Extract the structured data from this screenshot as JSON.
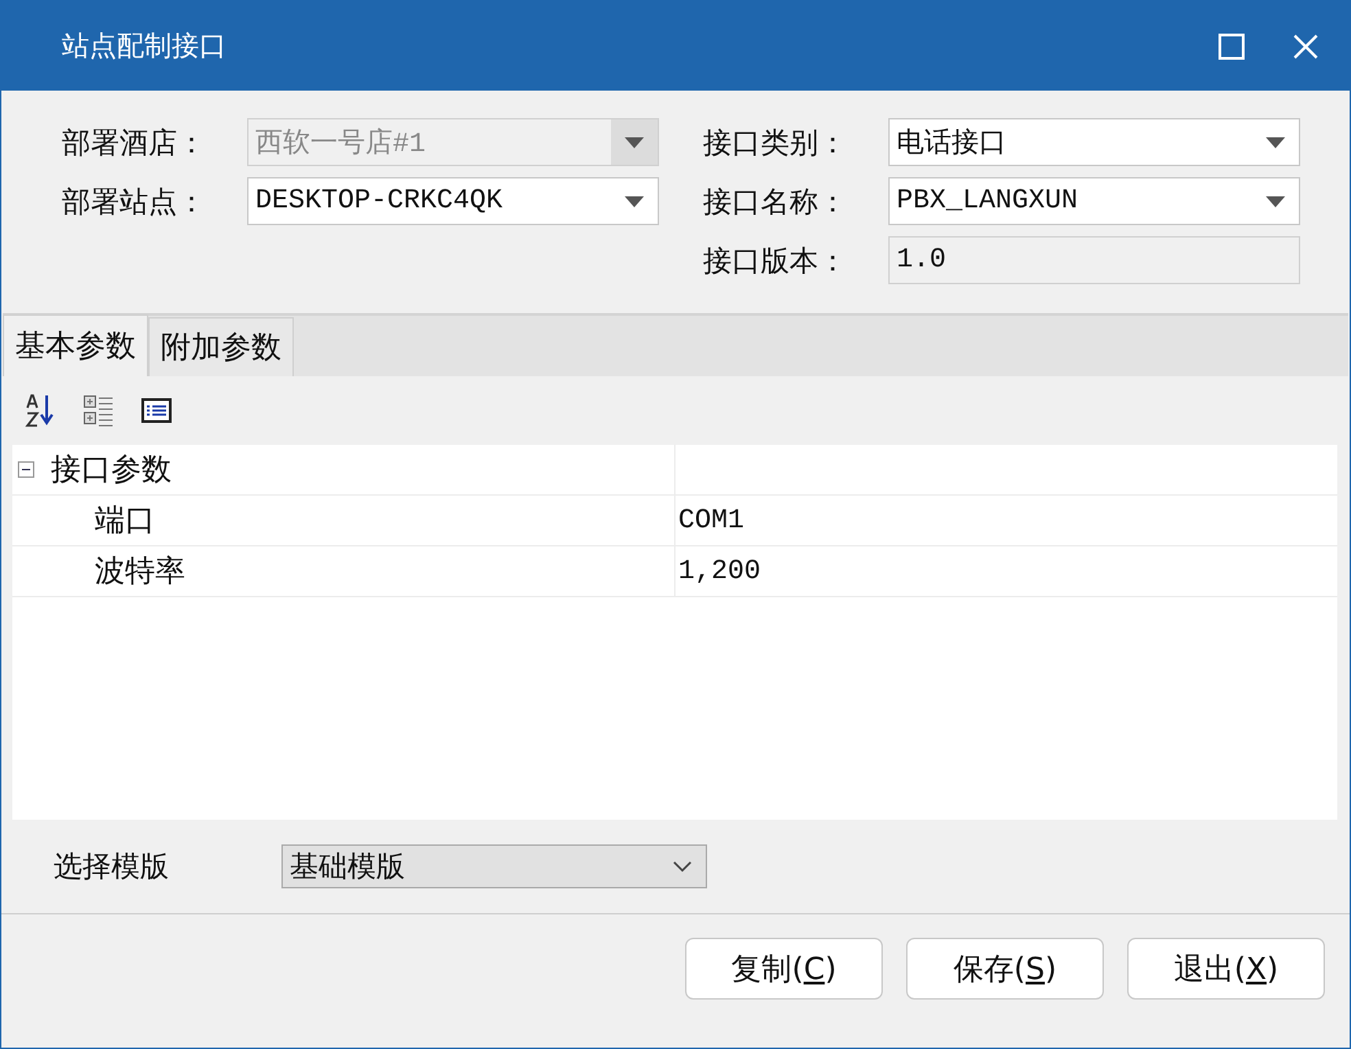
{
  "window": {
    "title": "站点配制接口"
  },
  "left_fields": [
    {
      "label": "部署酒店：",
      "value": "西软一号店#1",
      "disabled": true
    },
    {
      "label": "部署站点：",
      "value": "DESKTOP-CRKC4QK",
      "disabled": false
    }
  ],
  "right_fields": [
    {
      "label": "接口类别：",
      "value": "电话接口",
      "kind": "dropdown"
    },
    {
      "label": "接口名称：",
      "value": "PBX_LANGXUN",
      "kind": "dropdown"
    },
    {
      "label": "接口版本：",
      "value": "1.0",
      "kind": "readonly"
    }
  ],
  "tabs": [
    {
      "label": "基本参数",
      "selected": true
    },
    {
      "label": "附加参数",
      "selected": false
    }
  ],
  "property_grid": {
    "categories": [
      {
        "name": "接口参数",
        "expanded": true,
        "children": [
          {
            "name": "端口",
            "value": "COM1"
          },
          {
            "name": "波特率",
            "value": "1,200"
          }
        ]
      }
    ]
  },
  "template": {
    "label": "选择模版",
    "value": "基础模版"
  },
  "buttons": [
    {
      "before": "复制(",
      "key": "C",
      "after": ")"
    },
    {
      "before": "保存(",
      "key": "S",
      "after": ")"
    },
    {
      "before": "退出(",
      "key": "X",
      "after": ")"
    }
  ]
}
